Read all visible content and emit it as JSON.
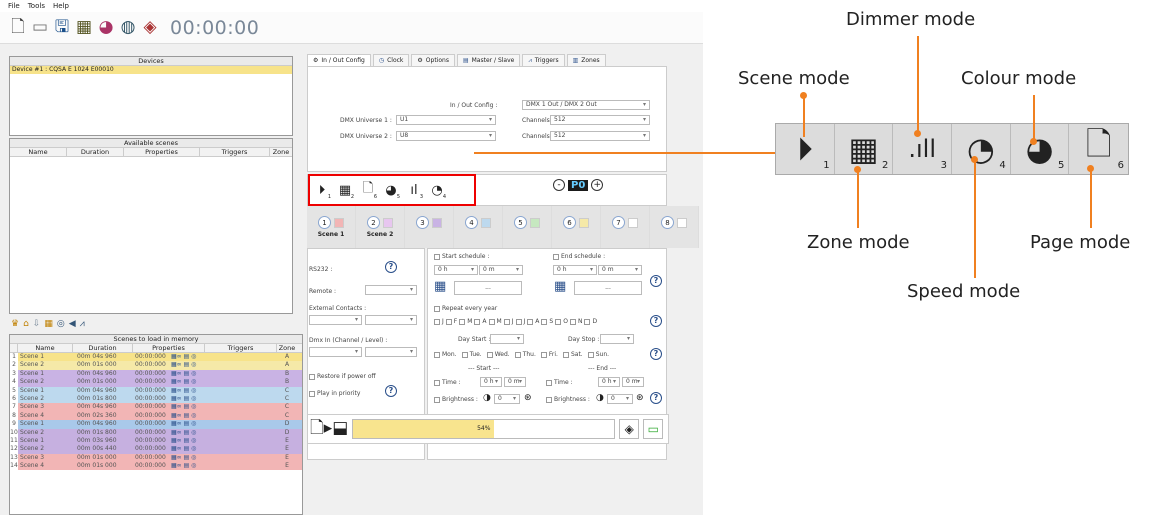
{
  "menu": [
    "File",
    "Tools",
    "Help"
  ],
  "timer": "00:00:00",
  "toolbar_icons": [
    "new-file-icon",
    "open-folder-icon",
    "save-icon",
    "grid-icon",
    "color-wheel-icon",
    "globe-icon",
    "cube-icon"
  ],
  "devices": {
    "title": "Devices",
    "item": "Device #1 : CQSA E 1024 E00010"
  },
  "available": {
    "title": "Available scenes",
    "columns": [
      "Name",
      "Duration",
      "Properties",
      "Triggers",
      "Zone"
    ]
  },
  "memory": {
    "title": "Scenes to load in memory",
    "columns": [
      "",
      "Name",
      "Duration",
      "Properties",
      "Triggers",
      "Zone"
    ],
    "rows": [
      {
        "n": "1",
        "name": "Scene 1",
        "dur": "00m 04s 960",
        "prop": "00:00:000",
        "zone": "A",
        "color": "#f7e38a"
      },
      {
        "n": "2",
        "name": "Scene 2",
        "dur": "00m 01s 000",
        "prop": "00:00:000",
        "zone": "A",
        "color": "#f5e9a8"
      },
      {
        "n": "3",
        "name": "Scene 1",
        "dur": "00m 04s 960",
        "prop": "00:00:000",
        "zone": "B",
        "color": "#c9b3e4"
      },
      {
        "n": "4",
        "name": "Scene 2",
        "dur": "00m 01s 000",
        "prop": "00:00:000",
        "zone": "B",
        "color": "#c9b3e4"
      },
      {
        "n": "5",
        "name": "Scene 1",
        "dur": "00m 04s 960",
        "prop": "00:00:000",
        "zone": "C",
        "color": "#bdd9ee"
      },
      {
        "n": "6",
        "name": "Scene 2",
        "dur": "00m 01s 800",
        "prop": "00:00:000",
        "zone": "C",
        "color": "#bdd9ee"
      },
      {
        "n": "7",
        "name": "Scene 3",
        "dur": "00m 04s 960",
        "prop": "00:00:000",
        "zone": "C",
        "color": "#f2b5b5"
      },
      {
        "n": "8",
        "name": "Scene 4",
        "dur": "00m 02s 360",
        "prop": "00:00:000",
        "zone": "C",
        "color": "#f2b5b5"
      },
      {
        "n": "9",
        "name": "Scene 1",
        "dur": "00m 04s 960",
        "prop": "00:00:000",
        "zone": "D",
        "color": "#a9c9ea"
      },
      {
        "n": "10",
        "name": "Scene 2",
        "dur": "00m 01s 800",
        "prop": "00:00:000",
        "zone": "D",
        "color": "#c6b0e0"
      },
      {
        "n": "11",
        "name": "Scene 1",
        "dur": "00m 03s 960",
        "prop": "00:00:000",
        "zone": "E",
        "color": "#c6b0e0"
      },
      {
        "n": "12",
        "name": "Scene 2",
        "dur": "00m 00s 440",
        "prop": "00:00:000",
        "zone": "E",
        "color": "#c6b0e0"
      },
      {
        "n": "13",
        "name": "Scene 3",
        "dur": "00m 01s 000",
        "prop": "00:00:000",
        "zone": "E",
        "color": "#f2b5b5"
      },
      {
        "n": "14",
        "name": "Scene 4",
        "dur": "00m 01s 000",
        "prop": "00:00:000",
        "zone": "E",
        "color": "#f2b5b5"
      }
    ]
  },
  "tabs": [
    "In / Out Config",
    "Clock",
    "Options",
    "Master / Slave",
    "Triggers",
    "Zones"
  ],
  "io": {
    "config_label": "In / Out Config :",
    "config_value": "DMX 1 Out / DMX 2 Out",
    "u1_label": "DMX Universe 1 :",
    "u1_value": "U1",
    "u2_label": "DMX Universe 2 :",
    "u2_value": "U8",
    "ch_label": "Channels :",
    "ch1": "512",
    "ch2": "512"
  },
  "page": "P0",
  "scenes": [
    {
      "num": "1",
      "label": "Scene 1",
      "color": "#f2b5b5"
    },
    {
      "num": "2",
      "label": "Scene 2",
      "color": "#e7c6ef"
    },
    {
      "num": "3",
      "label": "",
      "color": "#c9b3e4"
    },
    {
      "num": "4",
      "label": "",
      "color": "#bdd9ee"
    },
    {
      "num": "5",
      "label": "",
      "color": "#c6e8c0"
    },
    {
      "num": "6",
      "label": "",
      "color": "#f5e9a8"
    },
    {
      "num": "7",
      "label": "",
      "color": "#fff"
    },
    {
      "num": "8",
      "label": "",
      "color": "#fff"
    }
  ],
  "left": {
    "rs232": "RS232 :",
    "remote": "Remote :",
    "contacts": "External Contacts :",
    "dmxin": "Dmx In (Channel / Level) :",
    "restore": "Restore if power off",
    "priority": "Play in priority"
  },
  "sched": {
    "start": "Start schedule :",
    "end": "End schedule :",
    "h": "0 h",
    "m": "0 m",
    "dots": "...",
    "repeat": "Repeat every year",
    "months": [
      "J",
      "F",
      "M",
      "A",
      "M",
      "J",
      "J",
      "A",
      "S",
      "O",
      "N",
      "D"
    ],
    "day_start": "Day Start :",
    "day_stop": "Day Stop :",
    "days": [
      "Mon.",
      "Tue.",
      "Wed.",
      "Thu.",
      "Fri.",
      "Sat.",
      "Sun."
    ],
    "start_sep": "--- Start ---",
    "end_sep": "--- End ---",
    "time": "Time :",
    "brightness": "Brightness :",
    "bval": "0"
  },
  "progress": {
    "value": "54%",
    "fraction": 0.54
  },
  "annotations": {
    "dimmer": "Dimmer mode",
    "scene": "Scene mode",
    "colour": "Colour mode",
    "zone": "Zone mode",
    "page": "Page mode",
    "speed": "Speed mode"
  },
  "mode_nums": [
    "1",
    "2",
    "3",
    "4",
    "5",
    "6"
  ]
}
